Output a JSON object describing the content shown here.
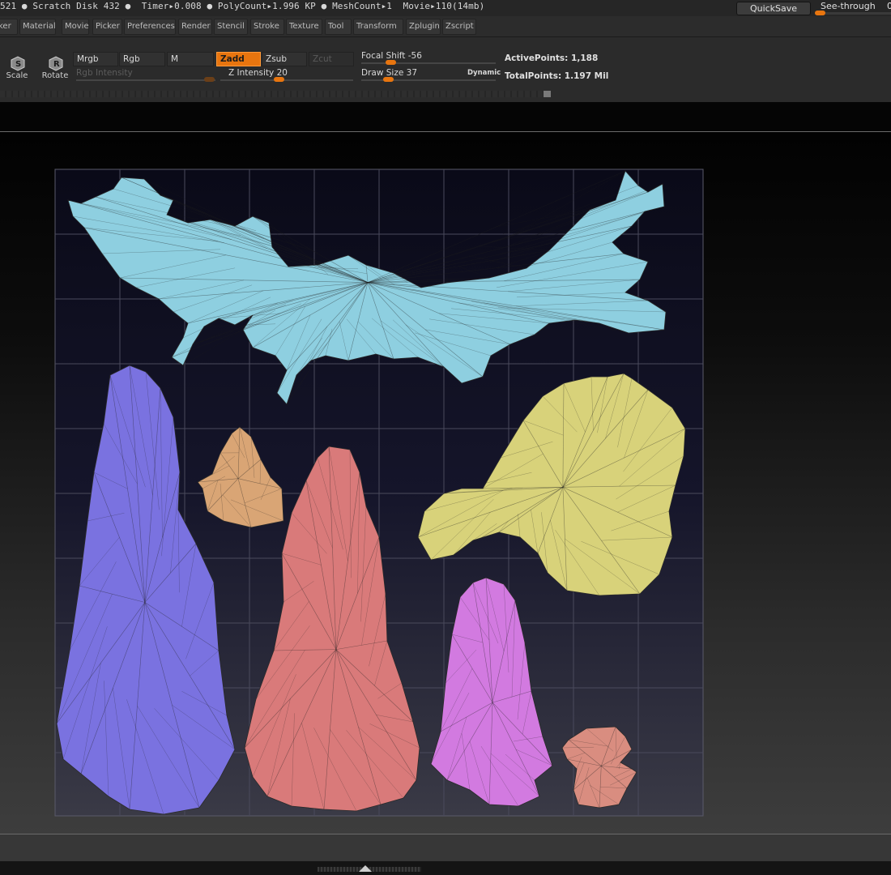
{
  "status_bar": {
    "text": "521 ● Scratch Disk 432 ●  Timer▸0.008 ● PolyCount▸1.996 KP ● MeshCount▸1  Movie▸110(14mb)",
    "quicksave_label": "QuickSave",
    "seethrough_label": "See-through",
    "seethrough_value": "0",
    "seethrough_level": 0
  },
  "menu": {
    "items": [
      "ker",
      "Material",
      "Movie",
      "Picker",
      "Preferences",
      "Render",
      "Stencil",
      "Stroke",
      "Texture",
      "Tool",
      "Transform",
      "Zplugin",
      "Zscript"
    ]
  },
  "toolbar": {
    "scale_label": "Scale",
    "rotate_label": "Rotate",
    "scale_icon": "scale-icon",
    "rotate_icon": "rotate-icon",
    "mrgb": "Mrgb",
    "rgb": "Rgb",
    "m": "M",
    "zadd": "Zadd",
    "zsub": "Zsub",
    "zcut": "Zcut",
    "rgb_intensity": "Rgb Intensity",
    "z_intensity": "Z Intensity 20",
    "focal_shift": "Focal Shift -56",
    "draw_size": "Draw Size 37",
    "dynamic": "Dynamic",
    "active_points": "ActivePoints: 1,188",
    "total_points": "TotalPoints: 1.197 Mil"
  },
  "colors": {
    "accent": "#e8750f",
    "uv_islands": [
      "#8ecfe0",
      "#7a72e0",
      "#d9a575",
      "#d97a7a",
      "#d8d27a",
      "#d27ae0",
      "#d98d80"
    ]
  }
}
